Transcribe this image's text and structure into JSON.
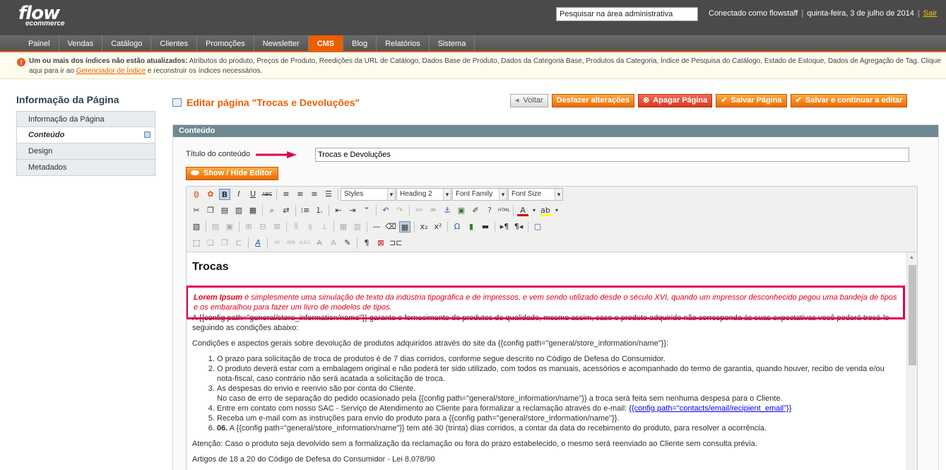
{
  "header": {
    "logo_top": "flow",
    "logo_bottom": "ecommerce",
    "search_value": "Pesquisar na área administrativa",
    "logged_as": "Conectado como flowstaff",
    "date": "quinta-feira, 3 de julho de 2014",
    "logout": "Sair"
  },
  "nav": {
    "items": [
      "Painel",
      "Vendas",
      "Catálogo",
      "Clientes",
      "Promoções",
      "Newsletter",
      "CMS",
      "Blog",
      "Relatórios",
      "Sistema"
    ],
    "active": "CMS"
  },
  "notice": {
    "bold": "Um ou mais dos índices não estão atualizados:",
    "text": " Atributos do produto, Preços de Produto, Reedições da URL de Catálogo, Dados Base de Produto, Dados da Categoria Base, Produtos da Categoria, Índice de Pesquisa do Catálogo, Estado de Estoque, Dados de Agregação de Tag. Clique aqui para ir ao ",
    "link": "Gerenciador de Índice",
    "tail": " e reconstruir os índices necessários."
  },
  "sidebar": {
    "title": "Informação da Página",
    "tabs": [
      "Informação da Página",
      "Conteúdo",
      "Design",
      "Metadados"
    ]
  },
  "page": {
    "title": "Editar página \"Trocas e Devoluções\"",
    "buttons": {
      "back": "Voltar",
      "reset": "Desfazer alterações",
      "delete": "Apagar Página",
      "save": "Salvar Página",
      "save_continue": "Salvar e continuar a editar"
    }
  },
  "fieldset": {
    "legend": "Conteúdo",
    "content_title_label": "Título do conteúdo",
    "content_title_value": "Trocas e Devoluções",
    "show_hide": "Show / Hide Editor"
  },
  "toolbar": {
    "styles": "Styles",
    "heading": "Heading 2",
    "font_family": "Font Family",
    "font_size": "Font Size"
  },
  "content": {
    "heading": "Trocas",
    "lorem_bold": "Lorem Ipsum",
    "lorem_text": " é simplesmente uma simulação de texto da indústria tipográfica e de impressos, e vem sendo utilizado desde o século XVI, quando um impressor desconhecido pegou uma bandeja de tipos e os embaralhou para fazer um livro de modelos de tipos.",
    "p1": "A {{config path=\"general/store_information/name\"}} garante o fornecimento de produtos de qualidade, mesmo assim, caso o produto adquirido não corresponda às suas expectativas você poderá trocá-lo seguindo as condições abaixo:",
    "p2": "Condições e aspectos gerais sobre devolução de produtos adquiridos através do site da {{config path=\"general/store_information/name\"}}:",
    "li1": "O prazo para solicitação de troca de produtos é de 7 dias corridos, conforme segue descrito no Código de Defesa do Consumidor.",
    "li2": "O produto deverá estar com a embalagem original e não poderá ter sido utilizado, com todos os manuais, acessórios e acompanhado do termo de garantia, quando houver, recibo de venda e/ou nota-fiscal, caso contrário não será acatada a solicitação de troca.",
    "li3a": "As despesas do envio e reenvio são por conta do Cliente.",
    "li3b": "No caso de erro de separação do pedido ocasionado pela {{config path=\"general/store_information/name\"}} a troca será feita sem nenhuma despesa para o Cliente.",
    "li4": "Entre em contato com nosso SAC - Serviço de Atendimento ao Cliente para formalizar a reclamação através do e-mail: ",
    "li4_link": "{{config path=\"contacts/email/recipient_email\"}}",
    "li5": "Receba um e-mail com as instruções para envio do produto para a {{config path=\"general/store_information/name\"}}.",
    "li6_bold": "06.",
    "li6": " A {{config path=\"general/store_information/name\"}} tem até 30 (trinta) dias corridos, a contar da data do recebimento do produto, para resolver a ocorrência.",
    "p3": "Atenção: Caso o produto seja devolvido sem a formalização da reclamação ou fora do prazo estabelecido, o mesmo será reenviado ao Cliente sem consulta prévia.",
    "p4": "Artigos de 18 a 20 do Código de Defesa do Consumidor - Lei 8.078/90"
  }
}
